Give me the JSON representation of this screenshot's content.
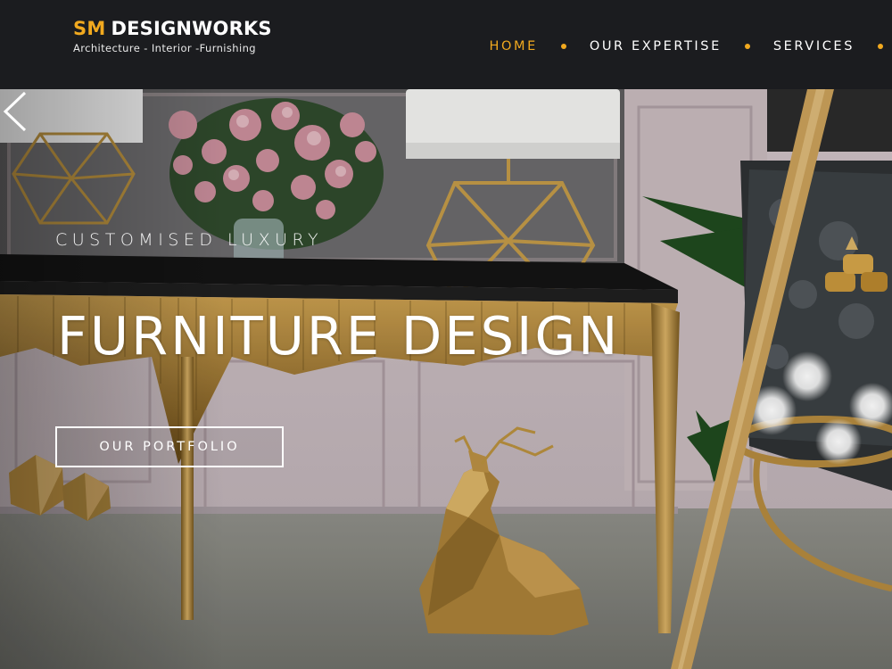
{
  "brand": {
    "initials": "SM",
    "name": "DESIGNWORKS",
    "tagline": "Architecture - Interior -Furnishing",
    "accent_color": "#f1a91f"
  },
  "nav": {
    "items": [
      {
        "label": "HOME",
        "active": true
      },
      {
        "label": "OUR EXPERTISE",
        "active": false
      },
      {
        "label": "SERVICES",
        "active": false
      }
    ]
  },
  "hero": {
    "kicker": "CUSTOMISED LUXURY",
    "title": "FURNITURE DESIGN",
    "cta_label": "OUR PORTFOLIO",
    "prev_icon": "chevron-left-icon"
  }
}
